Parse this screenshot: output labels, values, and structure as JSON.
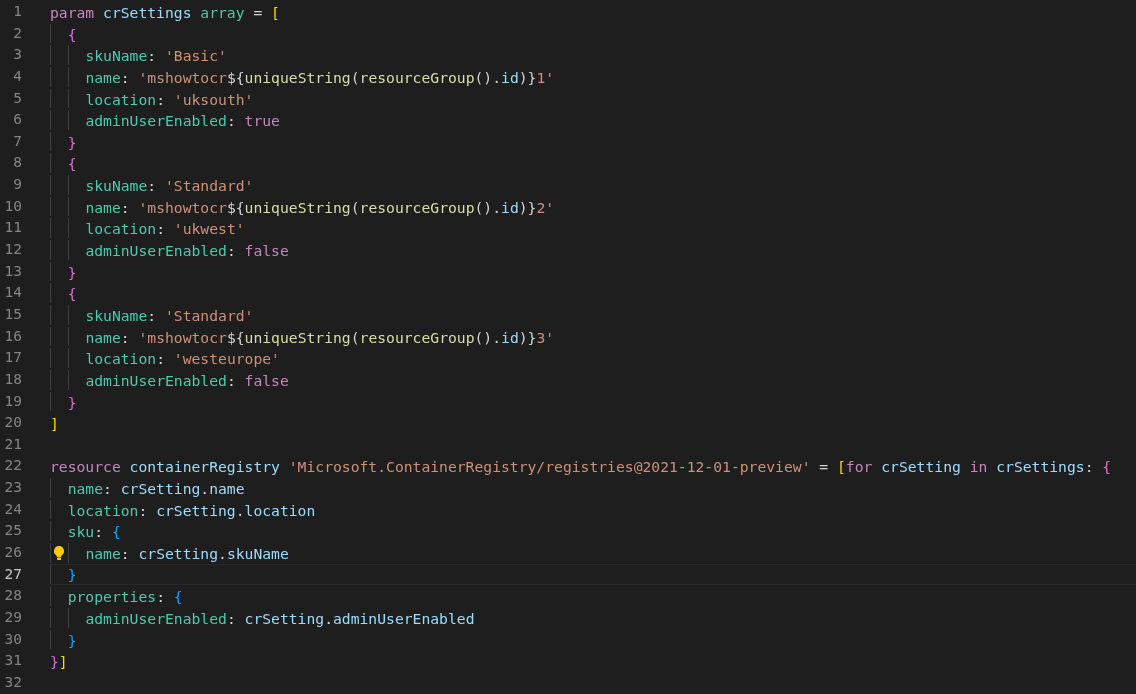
{
  "editor": {
    "lines": [
      {
        "number": "1",
        "current": false,
        "lightbulb": false,
        "tokens": [
          {
            "kind": "keyword",
            "text": "param"
          },
          {
            "kind": "variable",
            "text": " crSettings"
          },
          {
            "kind": "type",
            "text": " array"
          },
          {
            "kind": "op",
            "text": " = "
          },
          {
            "kind": "bracket1",
            "text": "["
          }
        ],
        "children": [
          {
            "number": "2",
            "current": false,
            "lightbulb": false,
            "tokens": [
              {
                "kind": "bracket2",
                "text": "{"
              }
            ],
            "children": [
              {
                "number": "3",
                "current": false,
                "lightbulb": false,
                "tokens": [
                  {
                    "kind": "property",
                    "text": "skuName"
                  },
                  {
                    "kind": "op",
                    "text": ": "
                  },
                  {
                    "kind": "string",
                    "text": "'Basic'"
                  }
                ]
              },
              {
                "number": "4",
                "current": false,
                "lightbulb": false,
                "tokens": [
                  {
                    "kind": "property",
                    "text": "name"
                  },
                  {
                    "kind": "op",
                    "text": ": "
                  },
                  {
                    "kind": "string",
                    "text": "'mshowtocr"
                  },
                  {
                    "kind": "op",
                    "text": "${"
                  },
                  {
                    "kind": "function",
                    "text": "uniqueString"
                  },
                  {
                    "kind": "op",
                    "text": "("
                  },
                  {
                    "kind": "function",
                    "text": "resourceGroup"
                  },
                  {
                    "kind": "op",
                    "text": "()."
                  },
                  {
                    "kind": "variable",
                    "text": "id"
                  },
                  {
                    "kind": "op",
                    "text": ")}"
                  },
                  {
                    "kind": "string",
                    "text": "1'"
                  }
                ]
              },
              {
                "number": "5",
                "current": false,
                "lightbulb": false,
                "tokens": [
                  {
                    "kind": "property",
                    "text": "location"
                  },
                  {
                    "kind": "op",
                    "text": ": "
                  },
                  {
                    "kind": "string",
                    "text": "'uksouth'"
                  }
                ]
              },
              {
                "number": "6",
                "current": false,
                "lightbulb": false,
                "tokens": [
                  {
                    "kind": "property",
                    "text": "adminUserEnabled"
                  },
                  {
                    "kind": "op",
                    "text": ": "
                  },
                  {
                    "kind": "keyword",
                    "text": "true"
                  }
                ]
              }
            ]
          },
          {
            "number": "7",
            "current": false,
            "lightbulb": false,
            "tokens": [
              {
                "kind": "bracket2",
                "text": "}"
              }
            ]
          },
          {
            "number": "8",
            "current": false,
            "lightbulb": false,
            "tokens": [
              {
                "kind": "bracket2",
                "text": "{"
              }
            ],
            "children": [
              {
                "number": "9",
                "current": false,
                "lightbulb": false,
                "tokens": [
                  {
                    "kind": "property",
                    "text": "skuName"
                  },
                  {
                    "kind": "op",
                    "text": ": "
                  },
                  {
                    "kind": "string",
                    "text": "'Standard'"
                  }
                ]
              },
              {
                "number": "10",
                "current": false,
                "lightbulb": false,
                "tokens": [
                  {
                    "kind": "property",
                    "text": "name"
                  },
                  {
                    "kind": "op",
                    "text": ": "
                  },
                  {
                    "kind": "string",
                    "text": "'mshowtocr"
                  },
                  {
                    "kind": "op",
                    "text": "${"
                  },
                  {
                    "kind": "function",
                    "text": "uniqueString"
                  },
                  {
                    "kind": "op",
                    "text": "("
                  },
                  {
                    "kind": "function",
                    "text": "resourceGroup"
                  },
                  {
                    "kind": "op",
                    "text": "()."
                  },
                  {
                    "kind": "variable",
                    "text": "id"
                  },
                  {
                    "kind": "op",
                    "text": ")}"
                  },
                  {
                    "kind": "string",
                    "text": "2'"
                  }
                ]
              },
              {
                "number": "11",
                "current": false,
                "lightbulb": false,
                "tokens": [
                  {
                    "kind": "property",
                    "text": "location"
                  },
                  {
                    "kind": "op",
                    "text": ": "
                  },
                  {
                    "kind": "string",
                    "text": "'ukwest'"
                  }
                ]
              },
              {
                "number": "12",
                "current": false,
                "lightbulb": false,
                "tokens": [
                  {
                    "kind": "property",
                    "text": "adminUserEnabled"
                  },
                  {
                    "kind": "op",
                    "text": ": "
                  },
                  {
                    "kind": "keyword",
                    "text": "false"
                  }
                ]
              }
            ]
          },
          {
            "number": "13",
            "current": false,
            "lightbulb": false,
            "tokens": [
              {
                "kind": "bracket2",
                "text": "}"
              }
            ]
          },
          {
            "number": "14",
            "current": false,
            "lightbulb": false,
            "tokens": [
              {
                "kind": "bracket2",
                "text": "{"
              }
            ],
            "children": [
              {
                "number": "15",
                "current": false,
                "lightbulb": false,
                "tokens": [
                  {
                    "kind": "property",
                    "text": "skuName"
                  },
                  {
                    "kind": "op",
                    "text": ": "
                  },
                  {
                    "kind": "string",
                    "text": "'Standard'"
                  }
                ]
              },
              {
                "number": "16",
                "current": false,
                "lightbulb": false,
                "tokens": [
                  {
                    "kind": "property",
                    "text": "name"
                  },
                  {
                    "kind": "op",
                    "text": ": "
                  },
                  {
                    "kind": "string",
                    "text": "'mshowtocr"
                  },
                  {
                    "kind": "op",
                    "text": "${"
                  },
                  {
                    "kind": "function",
                    "text": "uniqueString"
                  },
                  {
                    "kind": "op",
                    "text": "("
                  },
                  {
                    "kind": "function",
                    "text": "resourceGroup"
                  },
                  {
                    "kind": "op",
                    "text": "()."
                  },
                  {
                    "kind": "variable",
                    "text": "id"
                  },
                  {
                    "kind": "op",
                    "text": ")}"
                  },
                  {
                    "kind": "string",
                    "text": "3'"
                  }
                ]
              },
              {
                "number": "17",
                "current": false,
                "lightbulb": false,
                "tokens": [
                  {
                    "kind": "property",
                    "text": "location"
                  },
                  {
                    "kind": "op",
                    "text": ": "
                  },
                  {
                    "kind": "string",
                    "text": "'westeurope'"
                  }
                ]
              },
              {
                "number": "18",
                "current": false,
                "lightbulb": false,
                "tokens": [
                  {
                    "kind": "property",
                    "text": "adminUserEnabled"
                  },
                  {
                    "kind": "op",
                    "text": ": "
                  },
                  {
                    "kind": "keyword",
                    "text": "false"
                  }
                ]
              }
            ]
          },
          {
            "number": "19",
            "current": false,
            "lightbulb": false,
            "tokens": [
              {
                "kind": "bracket2",
                "text": "}"
              }
            ]
          }
        ]
      },
      {
        "number": "20",
        "current": false,
        "lightbulb": false,
        "tokens": [
          {
            "kind": "bracket1",
            "text": "]"
          }
        ]
      },
      {
        "number": "21",
        "current": false,
        "lightbulb": false
      },
      {
        "number": "22",
        "current": false,
        "lightbulb": false,
        "tokens": [
          {
            "kind": "keyword",
            "text": "resource"
          },
          {
            "kind": "variable",
            "text": " containerRegistry"
          },
          {
            "kind": "string",
            "text": " 'Microsoft.ContainerRegistry/registries@2021-12-01-preview'"
          },
          {
            "kind": "op",
            "text": " = "
          },
          {
            "kind": "bracket1",
            "text": "["
          },
          {
            "kind": "keyword",
            "text": "for"
          },
          {
            "kind": "variable",
            "text": " crSetting"
          },
          {
            "kind": "keyword",
            "text": " in"
          },
          {
            "kind": "variable",
            "text": " crSettings"
          },
          {
            "kind": "op",
            "text": ": "
          },
          {
            "kind": "bracket2",
            "text": "{"
          }
        ],
        "children": [
          {
            "number": "23",
            "current": false,
            "lightbulb": false,
            "tokens": [
              {
                "kind": "property",
                "text": "name"
              },
              {
                "kind": "op",
                "text": ": "
              },
              {
                "kind": "variable",
                "text": "crSetting"
              },
              {
                "kind": "op",
                "text": "."
              },
              {
                "kind": "variable",
                "text": "name"
              }
            ]
          },
          {
            "number": "24",
            "current": false,
            "lightbulb": false,
            "tokens": [
              {
                "kind": "property",
                "text": "location"
              },
              {
                "kind": "op",
                "text": ": "
              },
              {
                "kind": "variable",
                "text": "crSetting"
              },
              {
                "kind": "op",
                "text": "."
              },
              {
                "kind": "variable",
                "text": "location"
              }
            ]
          },
          {
            "number": "25",
            "current": false,
            "lightbulb": false,
            "tokens": [
              {
                "kind": "property",
                "text": "sku"
              },
              {
                "kind": "op",
                "text": ": "
              },
              {
                "kind": "bracket3",
                "text": "{"
              }
            ],
            "children": [
              {
                "number": "26",
                "current": false,
                "lightbulb": true,
                "tokens": [
                  {
                    "kind": "property",
                    "text": "name"
                  },
                  {
                    "kind": "op",
                    "text": ": "
                  },
                  {
                    "kind": "variable",
                    "text": "crSetting"
                  },
                  {
                    "kind": "op",
                    "text": "."
                  },
                  {
                    "kind": "variable",
                    "text": "skuName"
                  }
                ]
              }
            ]
          },
          {
            "number": "27",
            "current": true,
            "lightbulb": false,
            "tokens": [
              {
                "kind": "bracket3",
                "text": "}"
              }
            ]
          },
          {
            "number": "28",
            "current": false,
            "lightbulb": false,
            "tokens": [
              {
                "kind": "property",
                "text": "properties"
              },
              {
                "kind": "op",
                "text": ": "
              },
              {
                "kind": "bracket3",
                "text": "{"
              }
            ],
            "children": [
              {
                "number": "29",
                "current": false,
                "lightbulb": false,
                "tokens": [
                  {
                    "kind": "property",
                    "text": "adminUserEnabled"
                  },
                  {
                    "kind": "op",
                    "text": ": "
                  },
                  {
                    "kind": "variable",
                    "text": "crSetting"
                  },
                  {
                    "kind": "op",
                    "text": "."
                  },
                  {
                    "kind": "variable",
                    "text": "adminUserEnabled"
                  }
                ]
              }
            ]
          },
          {
            "number": "30",
            "current": false,
            "lightbulb": false,
            "tokens": [
              {
                "kind": "bracket3",
                "text": "}"
              }
            ]
          }
        ]
      },
      {
        "number": "31",
        "current": false,
        "lightbulb": false,
        "tokens": [
          {
            "kind": "bracket2",
            "text": "}"
          },
          {
            "kind": "bracket1",
            "text": "]"
          }
        ]
      },
      {
        "number": "32",
        "current": false,
        "lightbulb": false
      }
    ]
  }
}
